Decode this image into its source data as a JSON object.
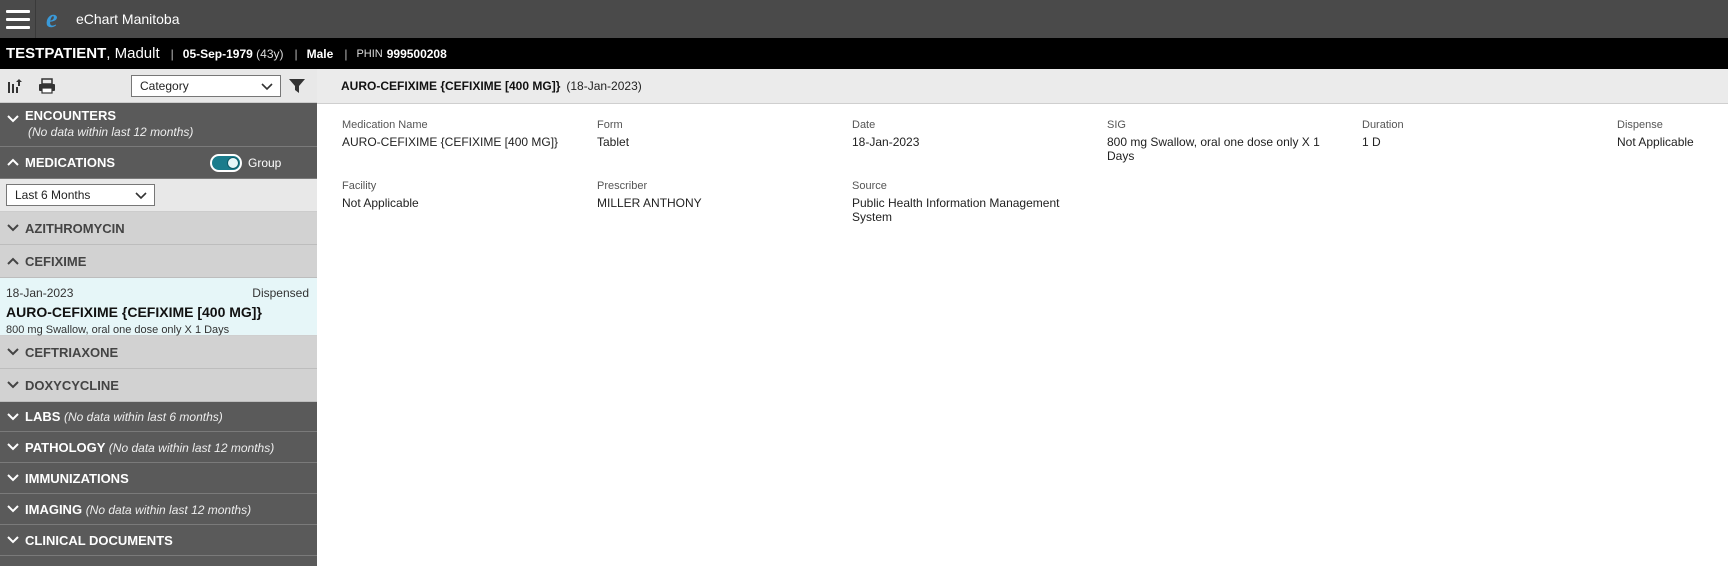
{
  "app": {
    "title": "eChart Manitoba",
    "logo_letter": "e"
  },
  "patient": {
    "last_name": "TESTPATIENT",
    "first_name": ", Madult",
    "dob": "05-Sep-1979",
    "age": "(43y)",
    "sex": "Male",
    "phin_label": "PHIN",
    "phin": "999500208"
  },
  "toolbar": {
    "category_select": "Category"
  },
  "sidebar": {
    "encounters": {
      "title": "ENCOUNTERS",
      "note": "(No data within last 12 months)"
    },
    "medications": {
      "title": "MEDICATIONS",
      "group_label": "Group",
      "period_select": "Last 6 Months"
    },
    "med_groups": [
      {
        "name": "AZITHROMYCIN",
        "expanded": false
      },
      {
        "name": "CEFIXIME",
        "expanded": true
      },
      {
        "name": "CEFTRIAXONE",
        "expanded": false
      },
      {
        "name": "DOXYCYCLINE",
        "expanded": false
      }
    ],
    "selected_med": {
      "date": "18-Jan-2023",
      "status": "Dispensed",
      "name": "AURO-CEFIXIME {CEFIXIME [400 MG]}",
      "sig": "800 mg Swallow, oral one dose only X 1 Days"
    },
    "labs": {
      "title": "LABS",
      "note": "(No data within last 6 months)"
    },
    "pathology": {
      "title": "PATHOLOGY",
      "note": "(No data within last 12 months)"
    },
    "immunizations": {
      "title": "IMMUNIZATIONS"
    },
    "imaging": {
      "title": "IMAGING",
      "note": "(No data within last 12 months)"
    },
    "clinical_documents": {
      "title": "CLINICAL DOCUMENTS"
    }
  },
  "detail": {
    "header_name": "AURO-CEFIXIME {CEFIXIME [400 MG]}",
    "header_date": "(18-Jan-2023)",
    "fields": {
      "medication_name": {
        "label": "Medication Name",
        "value": "AURO-CEFIXIME {CEFIXIME [400 MG]}"
      },
      "form": {
        "label": "Form",
        "value": "Tablet"
      },
      "date": {
        "label": "Date",
        "value": "18-Jan-2023"
      },
      "sig": {
        "label": "SIG",
        "value": "800 mg Swallow, oral one dose only X 1 Days"
      },
      "duration": {
        "label": "Duration",
        "value": "1 D"
      },
      "dispense": {
        "label": "Dispense",
        "value": "Not Applicable"
      },
      "facility": {
        "label": "Facility",
        "value": "Not Applicable"
      },
      "prescriber": {
        "label": "Prescriber",
        "value": "MILLER ANTHONY"
      },
      "source": {
        "label": "Source",
        "value": "Public Health Information Management System"
      }
    }
  },
  "colors": {
    "accent": "#1b7c8c",
    "appbar": "#4a4a4a",
    "sidebar": "#5a5a5a",
    "selected": "#e6f6f8"
  }
}
